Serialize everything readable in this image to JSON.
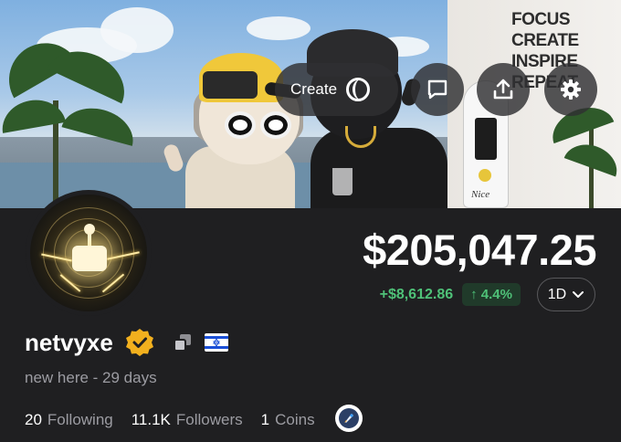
{
  "banner": {
    "wall_text": [
      "FOCUS",
      "CREATE",
      "INSPIRE",
      "REPEAT"
    ],
    "surfboard_text": "Nice"
  },
  "toolbar": {
    "create_label": "Create",
    "create_icon": "ring-icon",
    "buttons": [
      {
        "icon": "comment-icon"
      },
      {
        "icon": "share-icon"
      },
      {
        "icon": "gear-icon"
      }
    ]
  },
  "profile": {
    "balance": "$205,047.25",
    "change_abs": "+$8,612.86",
    "change_pct": "4.4%",
    "change_color": "#4fc178",
    "range": "1D",
    "username": "netvyxe",
    "verified_color": "#f2b01e",
    "flag": "Israel flag",
    "bio": "new here - 29 days",
    "stats": [
      {
        "value": "20",
        "label": "Following"
      },
      {
        "value": "11.1K",
        "label": "Followers"
      },
      {
        "value": "1",
        "label": "Coins"
      }
    ]
  }
}
